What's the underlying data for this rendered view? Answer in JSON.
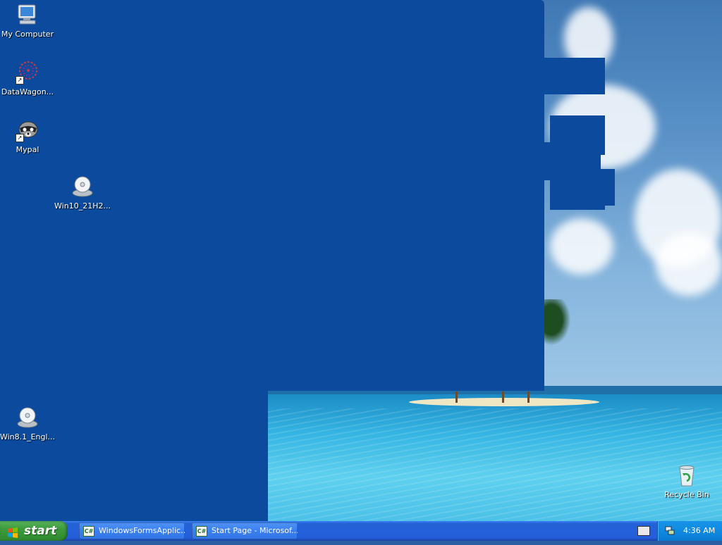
{
  "desktop": {
    "icons": [
      {
        "label": "My Computer",
        "icon": "my-computer-icon"
      },
      {
        "label": "DataWagon...",
        "icon": "datawagon-icon"
      },
      {
        "label": "Mypal",
        "icon": "mypal-raccoon-icon"
      },
      {
        "label": "Win10_21H2...",
        "icon": "disc-image-icon"
      },
      {
        "label": "Win8.1_Engl...",
        "icon": "disc-image-icon"
      },
      {
        "label": "Recycle Bin",
        "icon": "recycle-bin-icon"
      }
    ]
  },
  "taskbar": {
    "start_label": "start",
    "tasks": [
      {
        "label": "WindowsFormsApplic...",
        "icon": "csharp-app-icon"
      },
      {
        "label": "Start Page - Microsof...",
        "icon": "csharp-app-icon"
      }
    ],
    "tray": {
      "keyboard_icon": "keyboard-icon",
      "network_icon": "network-icon",
      "clock": "4:36 AM"
    }
  },
  "colors": {
    "window_blue": "#0b4a9c",
    "taskbar_blue": "#245edb",
    "start_green": "#3c9a3c"
  }
}
